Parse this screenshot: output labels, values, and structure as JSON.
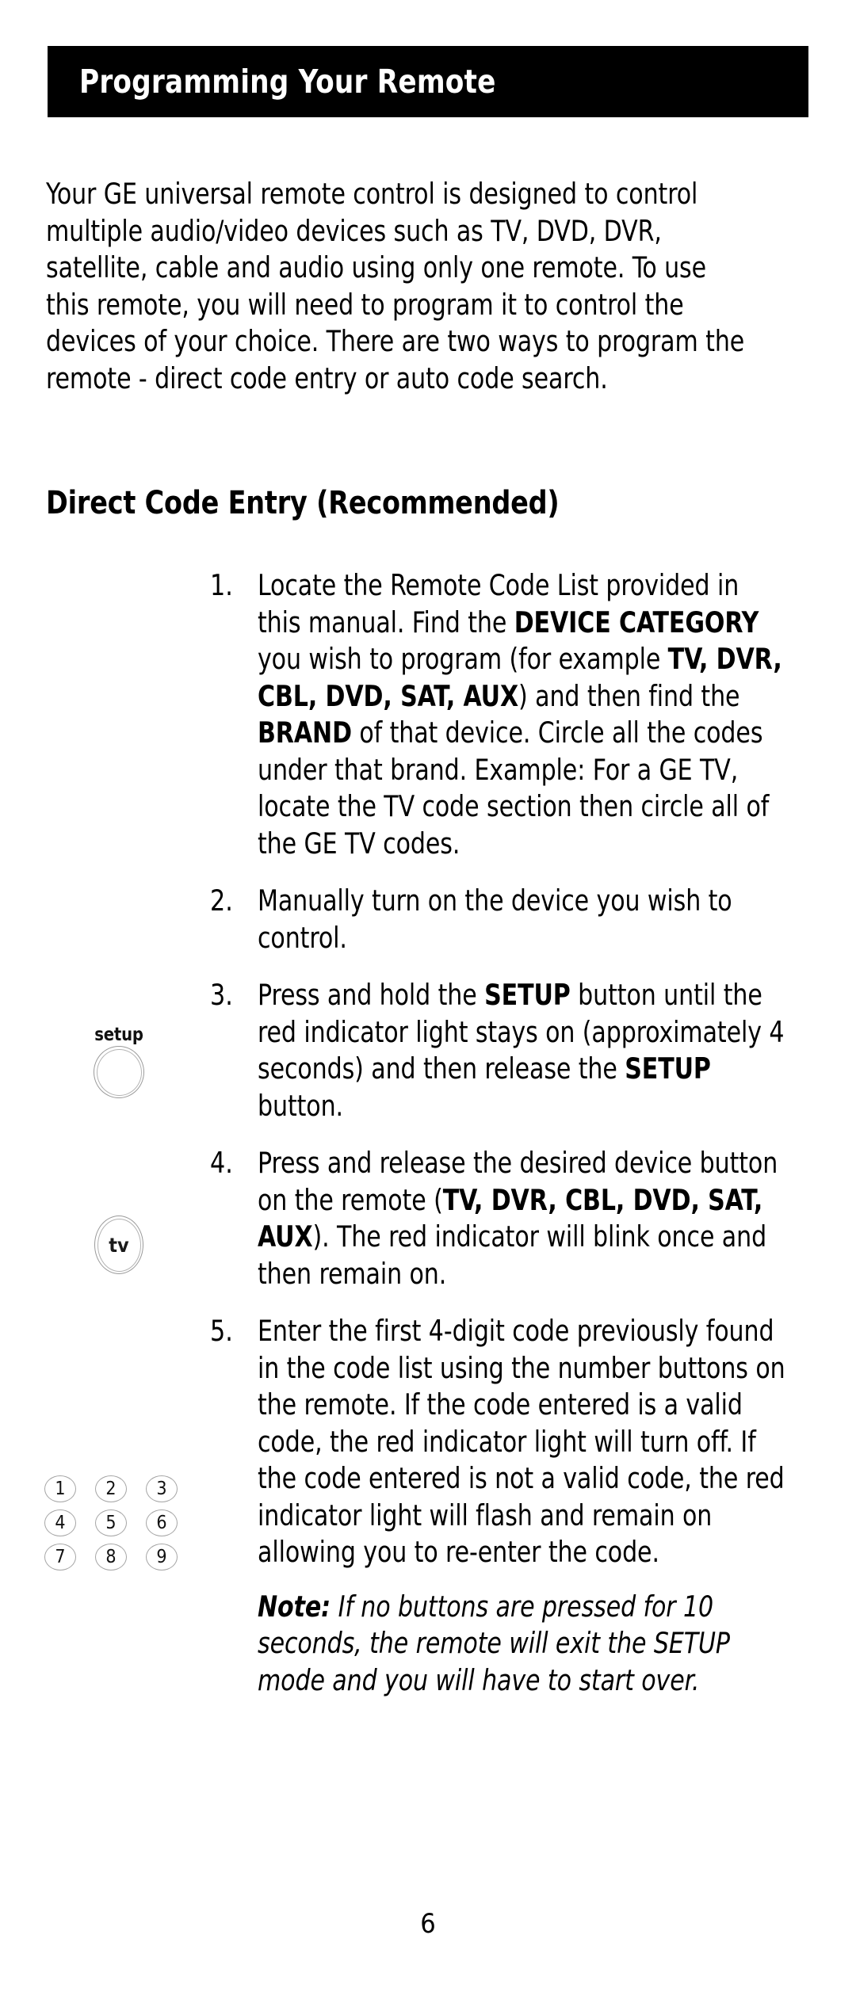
{
  "header": {
    "title": "Programming Your Remote"
  },
  "intro": {
    "paragraph": "Your GE universal remote control is designed to control multiple audio/video devices such as TV, DVD, DVR, satellite, cable and audio using only one remote. To use this remote, you will need to program it to control the devices of your choice. There are two ways to program the remote - direct code entry or auto code search."
  },
  "section": {
    "heading": "Direct Code Entry (Recommended)"
  },
  "steps": [
    {
      "number": "1.",
      "html": "Locate the Remote Code List provided in this manual. Find the <b>DEVICE CATEGORY</b> you wish to program (for example <b>TV, DVR, CBL, DVD, SAT, AUX</b>) and then find the <b>BRAND</b> of that device. Circle all the codes under that brand. Example: For a GE TV, locate the TV code section then circle all of the GE TV codes."
    },
    {
      "number": "2.",
      "html": "Manually turn on the device you wish to control."
    },
    {
      "number": "3.",
      "html": "Press and hold the <b>SETUP</b> button until the red indicator light stays on (approximately 4 seconds) and then release the <b>SETUP</b> button."
    },
    {
      "number": "4.",
      "html": "Press and release the desired device button on the remote (<b>TV, DVR, CBL, DVD, SAT, AUX</b>). The red indicator will blink once and then remain on."
    },
    {
      "number": "5.",
      "html": "Enter the first 4-digit code previously found in the code list using the number buttons on the remote. If the code entered is a valid code, the red indicator light will turn off. If the code entered is not a valid code, the red indicator light will flash and remain on allowing you to re-enter the code."
    }
  ],
  "note": {
    "html": "<b>Note:</b> If no buttons are pressed for 10 seconds, the remote will exit the SETUP mode and you will have to start over."
  },
  "illustrations": {
    "setup_button_label": "setup",
    "tv_button_label": "tv",
    "keypad_rows": [
      [
        "1",
        "2",
        "3"
      ],
      [
        "4",
        "5",
        "6"
      ],
      [
        "7",
        "8",
        "9"
      ]
    ]
  },
  "footer": {
    "page_number": "6"
  },
  "colors": {
    "banner_background": "#000000",
    "banner_text": "#ffffff",
    "body_text": "#000000",
    "button_outline": "#a5a5a5"
  }
}
